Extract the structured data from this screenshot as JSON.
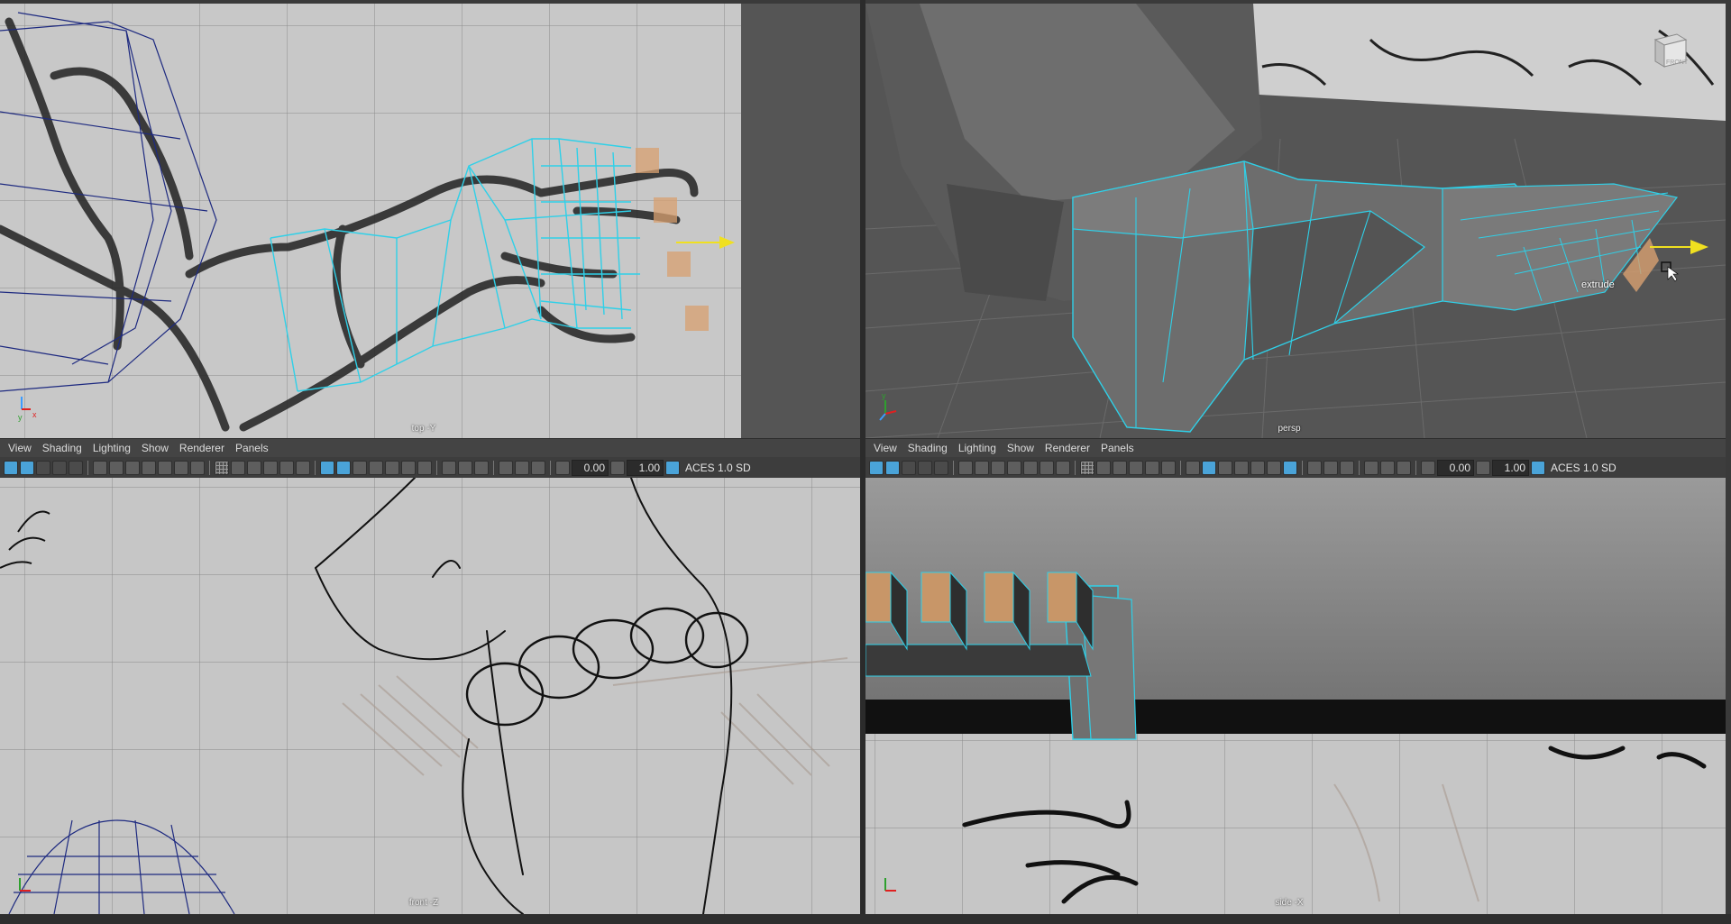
{
  "viewports": {
    "top": {
      "label": "top -Y"
    },
    "persp": {
      "label": "persp",
      "tooltip": "extrude",
      "cube_label": "FRONT"
    },
    "front": {
      "label": "front -Z"
    },
    "side": {
      "label": "side -X"
    }
  },
  "panel_menus": [
    "View",
    "Shading",
    "Lighting",
    "Show",
    "Renderer",
    "Panels"
  ],
  "toolbar": {
    "exposure": "0.00",
    "gamma": "1.00",
    "color_space": "ACES 1.0 SD"
  },
  "colors": {
    "selection": "#2fd0e8",
    "face_highlight": "#d8a070",
    "wire_blue": "#1e2a80",
    "manipulator": "#f0e020"
  }
}
